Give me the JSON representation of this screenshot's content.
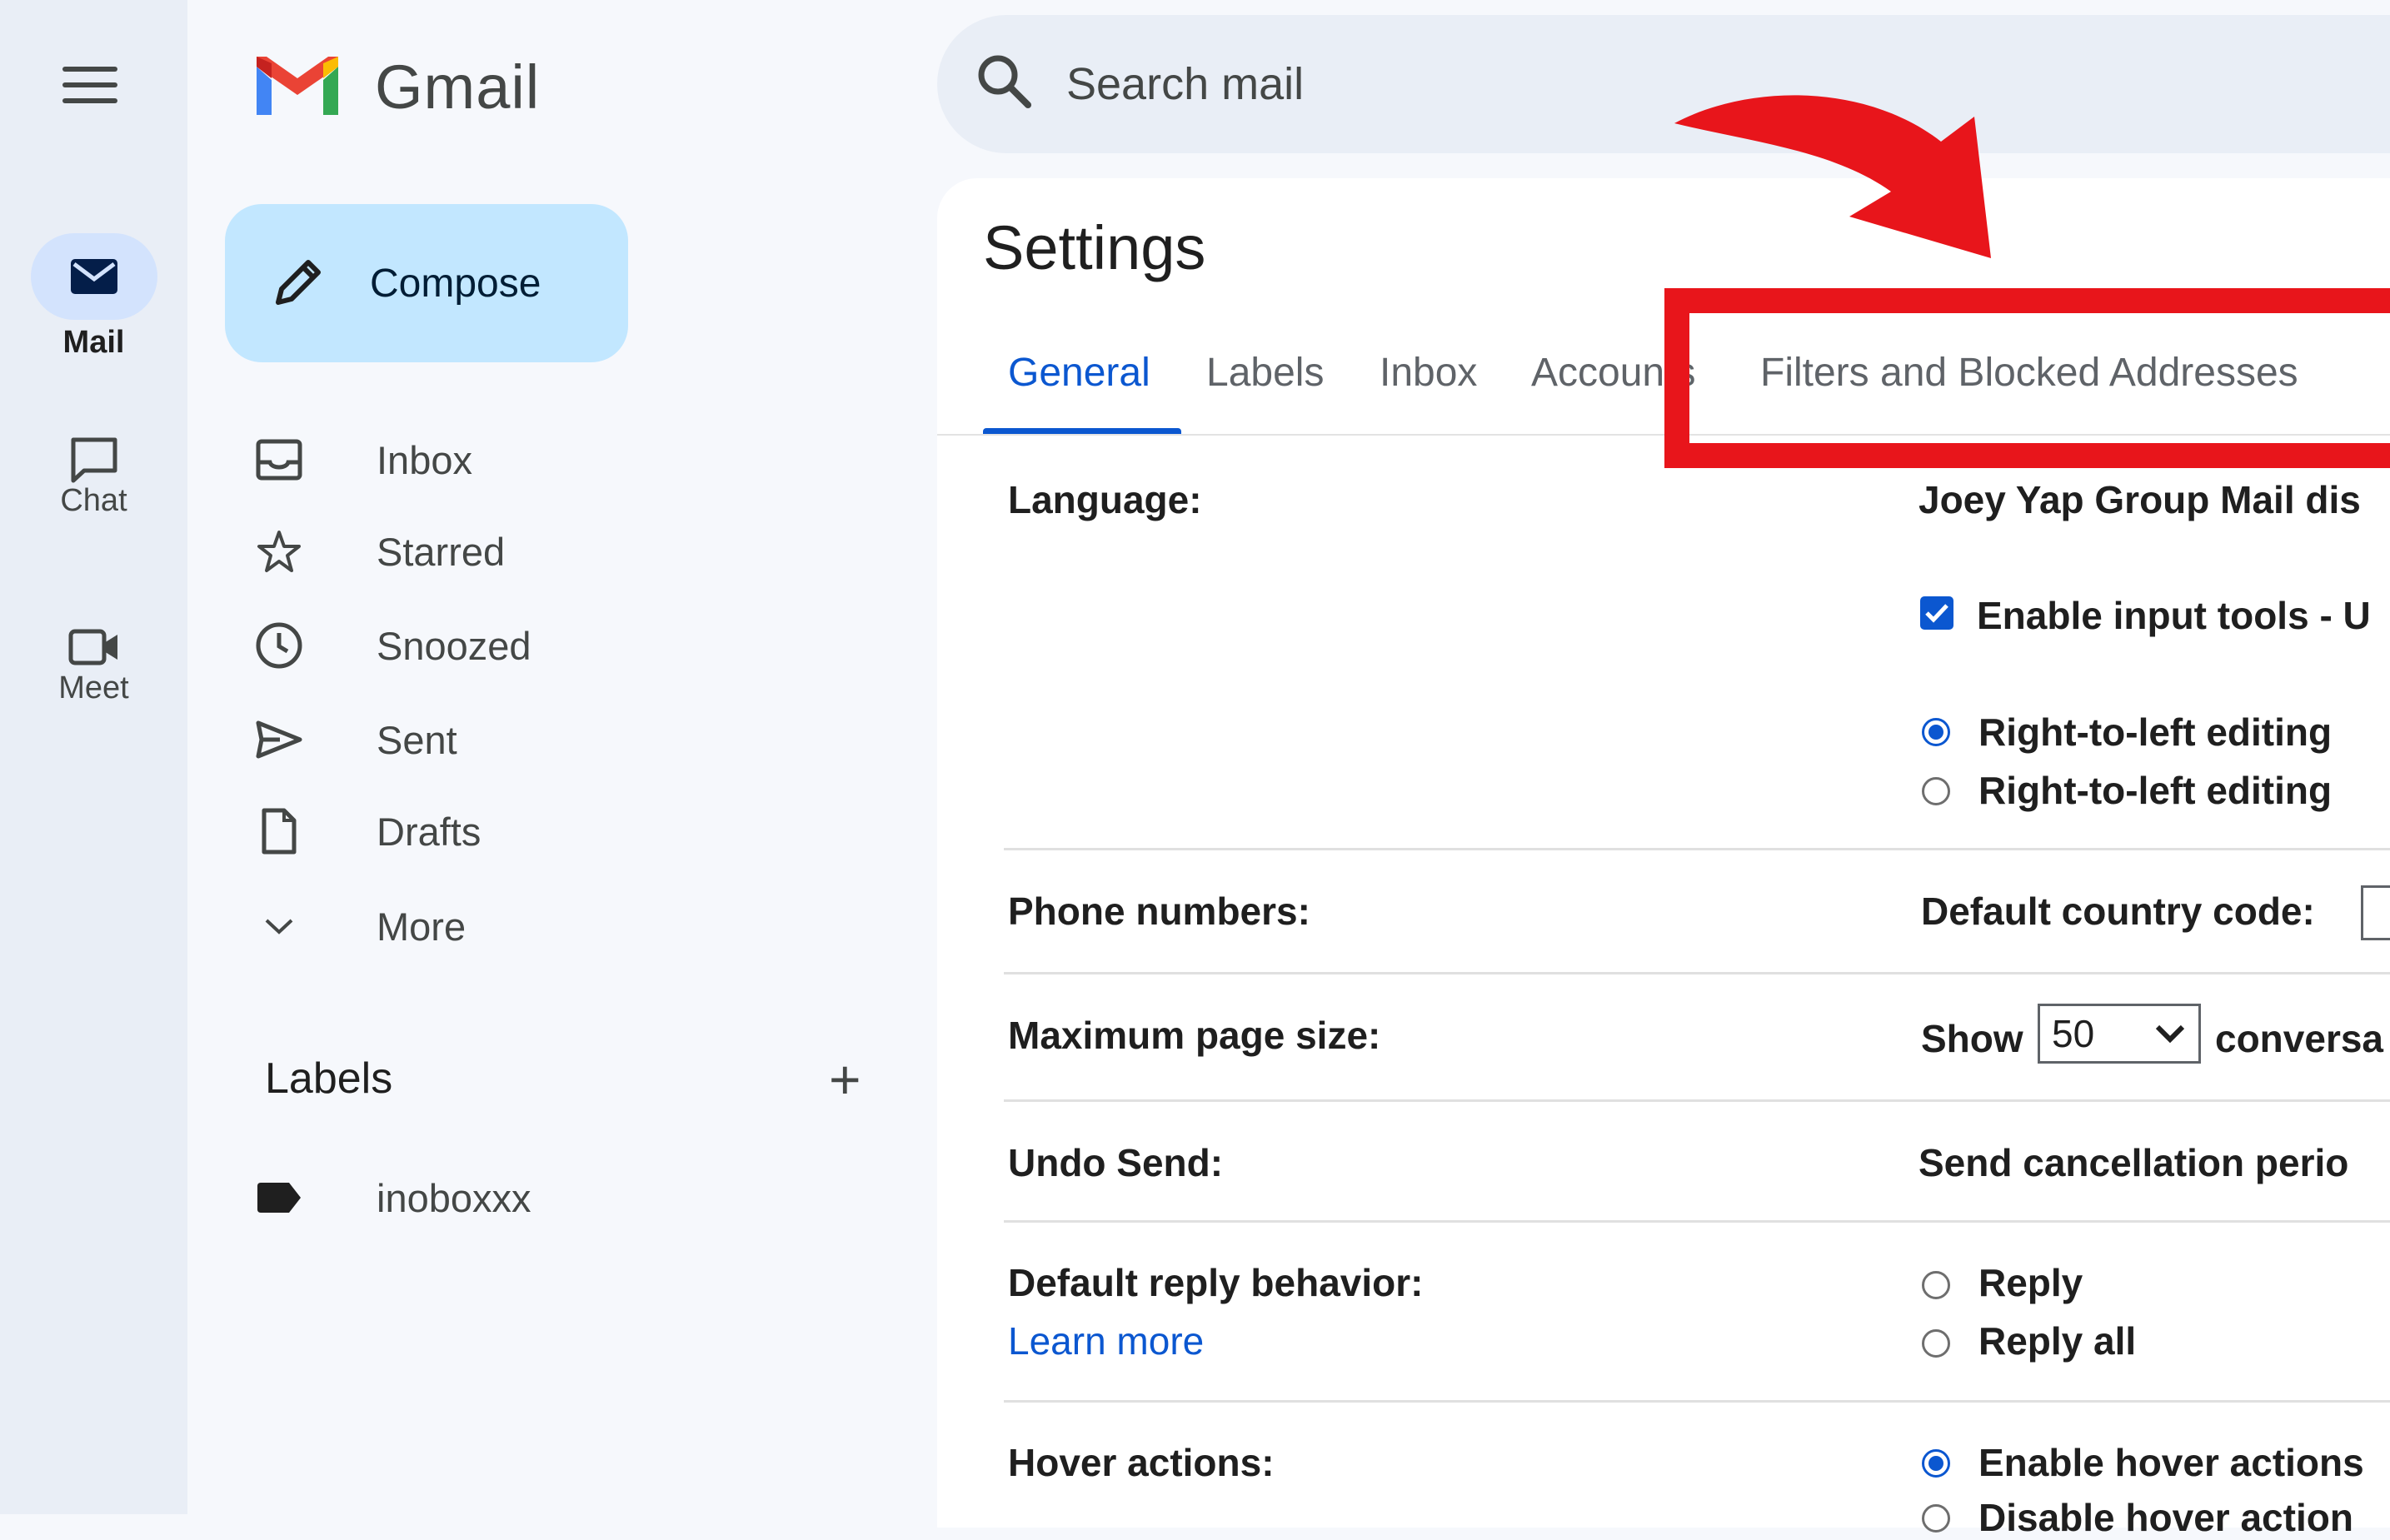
{
  "app": {
    "name": "Gmail"
  },
  "rail": {
    "items": [
      {
        "label": "Mail",
        "icon": "mail-icon",
        "active": true
      },
      {
        "label": "Chat",
        "icon": "chat-icon",
        "active": false
      },
      {
        "label": "Meet",
        "icon": "meet-icon",
        "active": false
      }
    ]
  },
  "nav": {
    "compose_label": "Compose",
    "items": [
      {
        "label": "Inbox",
        "icon": "inbox-icon"
      },
      {
        "label": "Starred",
        "icon": "star-icon"
      },
      {
        "label": "Snoozed",
        "icon": "clock-icon"
      },
      {
        "label": "Sent",
        "icon": "send-icon"
      },
      {
        "label": "Drafts",
        "icon": "draft-icon"
      },
      {
        "label": "More",
        "icon": "chevron-down-icon"
      }
    ],
    "labels_heading": "Labels",
    "labels_add": "+",
    "labels": [
      {
        "label": "inoboxxx",
        "icon": "label-icon"
      }
    ]
  },
  "search": {
    "placeholder": "Search mail"
  },
  "settings": {
    "title": "Settings",
    "tabs": [
      "General",
      "Labels",
      "Inbox",
      "Accounts",
      "Filters and Blocked Addresses"
    ],
    "active_tab": "General",
    "rows": {
      "language": {
        "label": "Language:",
        "value": "Joey Yap Group Mail dis",
        "input_tools": "Enable input tools - U",
        "rtl_on": "Right-to-left editing",
        "rtl_off": "Right-to-left editing"
      },
      "phone": {
        "label": "Phone numbers:",
        "value": "Default country code:"
      },
      "page_size": {
        "label": "Maximum page size:",
        "prefix": "Show",
        "select_value": "50",
        "suffix": "conversa"
      },
      "undo_send": {
        "label": "Undo Send:",
        "value": "Send cancellation perio"
      },
      "reply": {
        "label": "Default reply behavior:",
        "learn_more": "Learn more",
        "option_reply": "Reply",
        "option_reply_all": "Reply all"
      },
      "hover": {
        "label": "Hover actions:",
        "option_enable": "Enable hover actions",
        "option_disable": "Disable hover action"
      }
    }
  },
  "colors": {
    "accent": "#0b57d0",
    "annotation": "#e8151b",
    "compose_bg": "#c2e7ff"
  }
}
